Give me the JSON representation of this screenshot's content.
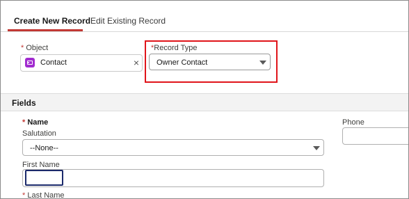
{
  "tabs": [
    {
      "label": "Create New Record",
      "active": true
    },
    {
      "label": "Edit Existing Record",
      "active": false
    }
  ],
  "object": {
    "required_mark": "*",
    "label": "Object",
    "value": "Contact",
    "icon": "contact-icon",
    "clear_icon": "×"
  },
  "record_type": {
    "required_mark": "*",
    "label": "Record Type",
    "value": "Owner Contact",
    "highlight_color": "#e0141a"
  },
  "fields_section": {
    "title": "Fields"
  },
  "name": {
    "required_mark": "*",
    "label": "Name",
    "salutation_label": "Salutation",
    "salutation_value": "--None--",
    "first_name_label": "First Name",
    "first_name_value": "",
    "last_name_label": "Last Name"
  },
  "phone": {
    "label": "Phone",
    "value": ""
  },
  "colors": {
    "accent": "#c23934",
    "object_icon": "#a12ccf",
    "focus": "#1b2a6b"
  }
}
